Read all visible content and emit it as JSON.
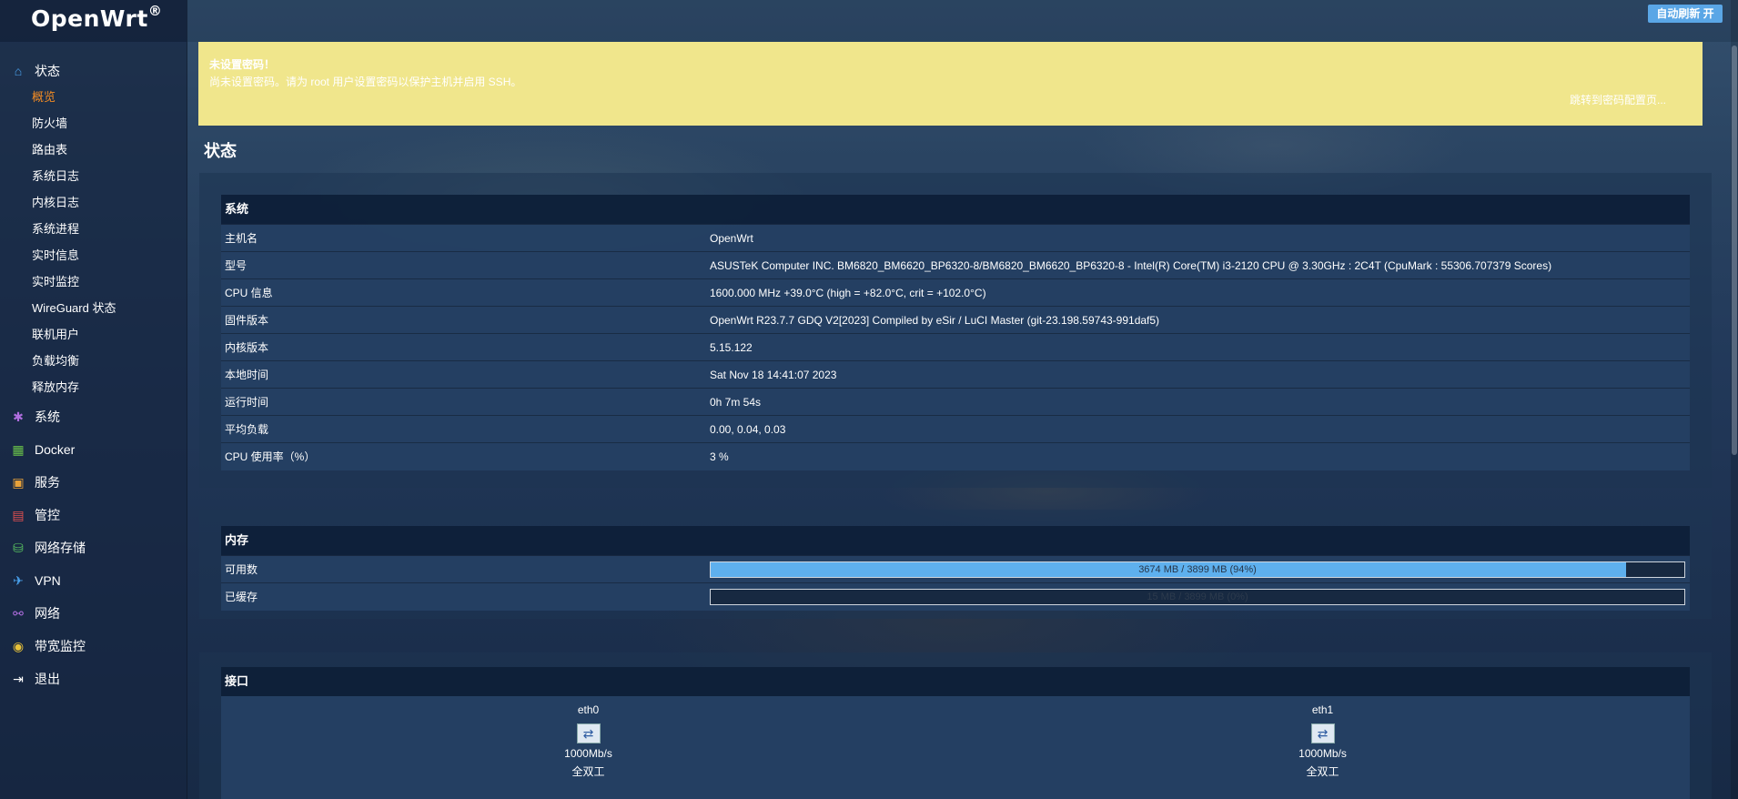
{
  "app": {
    "logo": "OpenWrt",
    "logo_mark": "®",
    "refresh_button": "自动刷新 开"
  },
  "sidebar": {
    "categories": [
      {
        "label": "状态",
        "icon": "home-icon",
        "color": "#4aa3f0",
        "items": [
          "概览",
          "防火墙",
          "路由表",
          "系统日志",
          "内核日志",
          "系统进程",
          "实时信息",
          "实时监控",
          "WireGuard 状态",
          "联机用户",
          "负载均衡",
          "释放内存"
        ],
        "active": "概览"
      },
      {
        "label": "系统",
        "icon": "gear-icon",
        "color": "#b06ee0"
      },
      {
        "label": "Docker",
        "icon": "docker-icon",
        "color": "#6ac24a"
      },
      {
        "label": "服务",
        "icon": "service-icon",
        "color": "#e8a23a"
      },
      {
        "label": "管控",
        "icon": "control-icon",
        "color": "#e25050"
      },
      {
        "label": "网络存储",
        "icon": "storage-icon",
        "color": "#58c060"
      },
      {
        "label": "VPN",
        "icon": "vpn-icon",
        "color": "#4aa3f0"
      },
      {
        "label": "网络",
        "icon": "network-icon",
        "color": "#b06ee0"
      },
      {
        "label": "带宽监控",
        "icon": "bandwidth-icon",
        "color": "#e8c23a"
      },
      {
        "label": "退出",
        "icon": "logout-icon",
        "color": "#ffffff"
      }
    ]
  },
  "alert": {
    "title": "未设置密码！",
    "message": "尚未设置密码。请为 root 用户设置密码以保护主机并启用 SSH。",
    "link": "跳转到密码配置页..."
  },
  "page": {
    "title": "状态"
  },
  "system": {
    "heading": "系统",
    "rows": [
      {
        "key": "主机名",
        "value": "OpenWrt"
      },
      {
        "key": "型号",
        "value": "ASUSTeK Computer INC. BM6820_BM6620_BP6320-8/BM6820_BM6620_BP6320-8 - Intel(R) Core(TM) i3-2120 CPU @ 3.30GHz : 2C4T (CpuMark : 55306.707379 Scores)"
      },
      {
        "key": "CPU 信息",
        "value": "1600.000 MHz +39.0°C (high = +82.0°C, crit = +102.0°C)"
      },
      {
        "key": "固件版本",
        "value": "OpenWrt R23.7.7 GDQ V2[2023] Compiled by eSir / LuCI Master (git-23.198.59743-991daf5)"
      },
      {
        "key": "内核版本",
        "value": "5.15.122"
      },
      {
        "key": "本地时间",
        "value": "Sat Nov 18 14:41:07 2023"
      },
      {
        "key": "运行时间",
        "value": "0h 7m 54s"
      },
      {
        "key": "平均负载",
        "value": "0.00, 0.04, 0.03"
      },
      {
        "key": "CPU 使用率（%）",
        "value": "3 %"
      }
    ]
  },
  "memory": {
    "heading": "内存",
    "rows": [
      {
        "key": "可用数",
        "text": "3674 MB / 3899 MB (94%)",
        "fraction": 0.94
      },
      {
        "key": "已缓存",
        "text": "15 MB / 3899 MB (0%)",
        "fraction": 0.0
      }
    ]
  },
  "interfaces": {
    "heading": "接口",
    "items": [
      {
        "name": "eth0",
        "speed": "1000Mb/s",
        "duplex": "全双工"
      },
      {
        "name": "eth1",
        "speed": "1000Mb/s",
        "duplex": "全双工"
      }
    ]
  }
}
